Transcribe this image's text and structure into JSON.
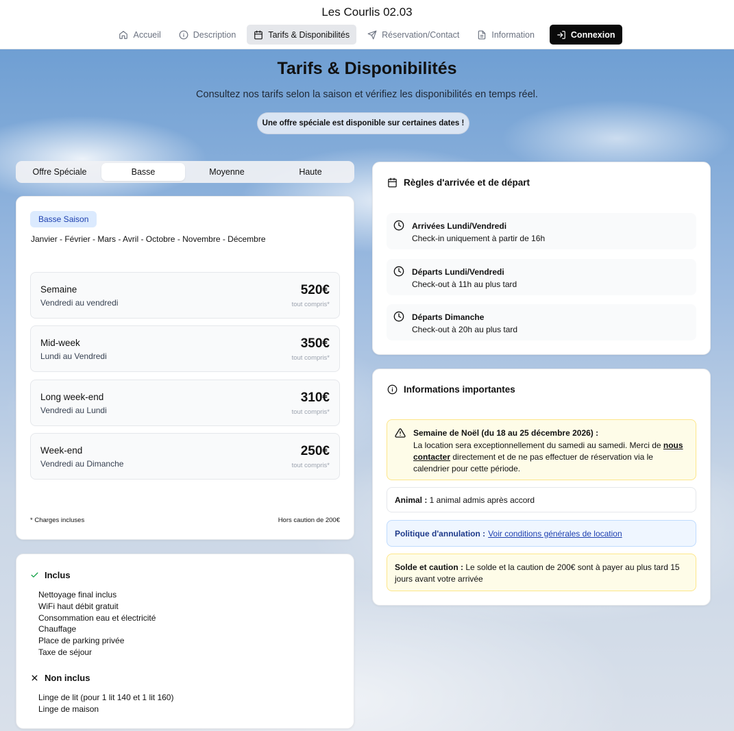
{
  "header": {
    "site_title": "Les Courlis 02.03",
    "nav": [
      {
        "label": "Accueil",
        "icon": "home-icon"
      },
      {
        "label": "Description",
        "icon": "info-icon"
      },
      {
        "label": "Tarifs & Disponibilités",
        "icon": "calendar-icon",
        "active": true
      },
      {
        "label": "Réservation/Contact",
        "icon": "send-icon"
      },
      {
        "label": "Information",
        "icon": "document-icon"
      }
    ],
    "login_label": "Connexion"
  },
  "hero": {
    "title": "Tarifs & Disponibilités",
    "subtitle": "Consultez nos tarifs selon la saison et vérifiez les disponibilités en temps réel.",
    "offer_notice": "Une offre spéciale est disponible sur certaines dates !"
  },
  "season_tabs": [
    {
      "label": "Offre Spéciale"
    },
    {
      "label": "Basse",
      "active": true
    },
    {
      "label": "Moyenne"
    },
    {
      "label": "Haute"
    }
  ],
  "pricing": {
    "badge": "Basse Saison",
    "months": "Janvier - Février - Mars - Avril - Octobre - Novembre - Décembre",
    "items": [
      {
        "name": "Semaine",
        "desc": "Vendredi au vendredi",
        "price": "520€",
        "note": "tout compris*"
      },
      {
        "name": "Mid-week",
        "desc": "Lundi au Vendredi",
        "price": "350€",
        "note": "tout compris*"
      },
      {
        "name": "Long week-end",
        "desc": "Vendredi au Lundi",
        "price": "310€",
        "note": "tout compris*"
      },
      {
        "name": "Week-end",
        "desc": "Vendredi au Dimanche",
        "price": "250€",
        "note": "tout compris*"
      }
    ],
    "footnote_left": "* Charges incluses",
    "footnote_right": "Hors caution de 200€"
  },
  "inclus": {
    "included_title": "Inclus",
    "included": [
      "Nettoyage final inclus",
      "WiFi haut débit gratuit",
      "Consommation eau et électricité",
      "Chauffage",
      "Place de parking privée",
      "Taxe de séjour"
    ],
    "excluded_title": "Non inclus",
    "excluded": [
      "Linge de lit (pour 1 lit 140 et 1 lit 160)",
      "Linge de maison"
    ]
  },
  "rules": {
    "title": "Règles d'arrivée et de départ",
    "items": [
      {
        "title": "Arrivées Lundi/Vendredi",
        "desc": "Check-in uniquement à partir de 16h"
      },
      {
        "title": "Départs Lundi/Vendredi",
        "desc": "Check-out à 11h au plus tard"
      },
      {
        "title": "Départs Dimanche",
        "desc": "Check-out à 20h au plus tard"
      }
    ]
  },
  "infos": {
    "title": "Informations importantes",
    "christmas": {
      "title": "Semaine de Noël (du 18 au 25 décembre 2026) :",
      "text_before": "La location sera exceptionnellement du samedi au samedi. Merci de ",
      "link": "nous contacter",
      "text_after": " directement et de ne pas effectuer de réservation via le calendrier pour cette période."
    },
    "animal_label": "Animal :",
    "animal_text": " 1 animal admis après accord",
    "cancel_label": "Politique d'annulation :",
    "cancel_link": "Voir conditions générales de location",
    "solde_label": "Solde et caution :",
    "solde_text": " Le solde et la caution de 200€ sont à payer au plus tard 15 jours avant votre arrivée"
  }
}
